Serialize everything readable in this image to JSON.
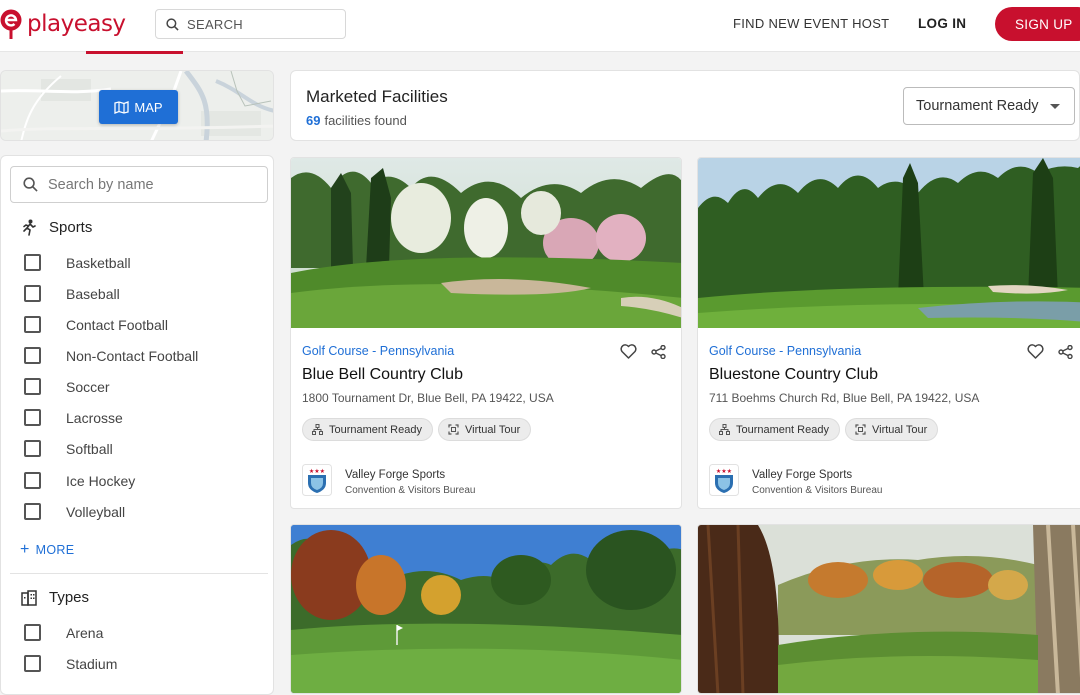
{
  "header": {
    "logo_text": "playeasy",
    "search_placeholder": "SEARCH",
    "nav_find": "FIND NEW EVENT HOST",
    "nav_login": "LOG IN",
    "nav_signup": "SIGN UP"
  },
  "map": {
    "button_label": "MAP"
  },
  "filters": {
    "search_placeholder": "Search by name",
    "sports_title": "Sports",
    "sports": [
      "Basketball",
      "Baseball",
      "Contact Football",
      "Non-Contact Football",
      "Soccer",
      "Lacrosse",
      "Softball",
      "Ice Hockey",
      "Volleyball"
    ],
    "more_label": "MORE",
    "types_title": "Types",
    "types": [
      "Arena",
      "Stadium"
    ]
  },
  "results": {
    "title": "Marketed Facilities",
    "count": "69",
    "count_suffix": "facilities found",
    "sort_selected": "Tournament Ready"
  },
  "cards": [
    {
      "category": "Golf Course - Pennsylvania",
      "title": "Blue Bell Country Club",
      "address": "1800 Tournament Dr, Blue Bell, PA 19422, USA",
      "chip1": "Tournament Ready",
      "chip2": "Virtual Tour",
      "host_name": "Valley Forge Sports",
      "host_sub": "Convention & Visitors Bureau"
    },
    {
      "category": "Golf Course - Pennsylvania",
      "title": "Bluestone Country Club",
      "address": "711 Boehms Church Rd, Blue Bell, PA 19422, USA",
      "chip1": "Tournament Ready",
      "chip2": "Virtual Tour",
      "host_name": "Valley Forge Sports",
      "host_sub": "Convention & Visitors Bureau"
    },
    {},
    {}
  ],
  "colors": {
    "brand": "#c8102e",
    "accent": "#1f6fd6"
  }
}
